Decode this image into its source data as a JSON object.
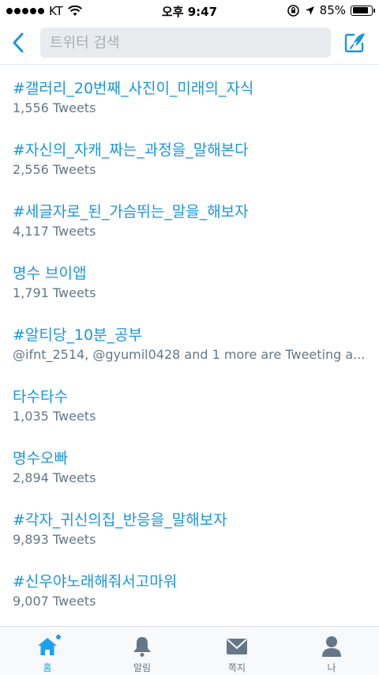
{
  "status_bar": {
    "carrier": "KT",
    "time": "오후 9:47",
    "battery_text": "85%",
    "battery_level": 0.85,
    "signal_bars": 5
  },
  "nav": {
    "search_placeholder": "트위터 검색",
    "back_icon": "chevron-left-icon",
    "compose_icon": "compose-icon",
    "accent_color": "#1b95e0"
  },
  "trends": [
    {
      "title": "#갤러리_20번째_사진이_미래의_자식",
      "subtitle": "1,556 Tweets"
    },
    {
      "title": "#자신의_자캐_짜는_과정을_말해본다",
      "subtitle": "2,556 Tweets"
    },
    {
      "title": "#세글자로_된_가슴뛰는_말을_해보자",
      "subtitle": "4,117 Tweets"
    },
    {
      "title": "명수 브이앱",
      "subtitle": "1,791 Tweets"
    },
    {
      "title": "#알티당_10분_공부",
      "subtitle": "@ifnt_2514, @gyumil0428 and 1 more are Tweeting a..."
    },
    {
      "title": "타수타수",
      "subtitle": "1,035 Tweets"
    },
    {
      "title": "명수오빠",
      "subtitle": "2,894 Tweets"
    },
    {
      "title": "#각자_귀신의집_반응을_말해보자",
      "subtitle": "9,893 Tweets"
    },
    {
      "title": "#신우야노래해줘서고마워",
      "subtitle": "9,007 Tweets"
    }
  ],
  "tabs": [
    {
      "label": "홈",
      "icon": "home-icon",
      "active": true
    },
    {
      "label": "알림",
      "icon": "bell-icon",
      "active": false
    },
    {
      "label": "쪽지",
      "icon": "envelope-icon",
      "active": false
    },
    {
      "label": "나",
      "icon": "person-icon",
      "active": false
    }
  ]
}
